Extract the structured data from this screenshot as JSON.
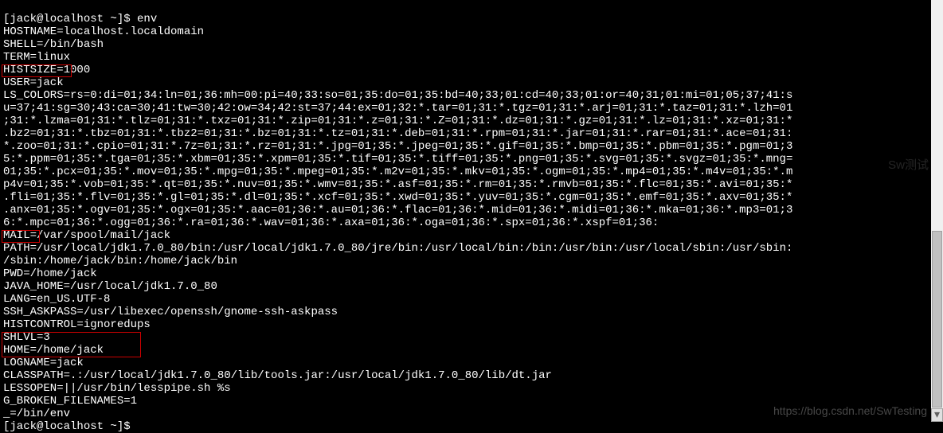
{
  "terminal": {
    "prompt1": "[jack@localhost ~]$ ",
    "cmd1": "env",
    "l1": "HOSTNAME=localhost.localdomain",
    "l2": "SHELL=/bin/bash",
    "l3": "TERM=linux",
    "l4": "HISTSIZE=1000",
    "l5": "USER=jack",
    "l6": "LS_COLORS=rs=0:di=01;34:ln=01;36:mh=00:pi=40;33:so=01;35:do=01;35:bd=40;33;01:cd=40;33;01:or=40;31;01:mi=01;05;37;41:s",
    "l7": "u=37;41:sg=30;43:ca=30;41:tw=30;42:ow=34;42:st=37;44:ex=01;32:*.tar=01;31:*.tgz=01;31:*.arj=01;31:*.taz=01;31:*.lzh=01",
    "l8": ";31:*.lzma=01;31:*.tlz=01;31:*.txz=01;31:*.zip=01;31:*.z=01;31:*.Z=01;31:*.dz=01;31:*.gz=01;31:*.lz=01;31:*.xz=01;31:*",
    "l9": ".bz2=01;31:*.tbz=01;31:*.tbz2=01;31:*.bz=01;31:*.tz=01;31:*.deb=01;31:*.rpm=01;31:*.jar=01;31:*.rar=01;31:*.ace=01;31:",
    "l10": "*.zoo=01;31:*.cpio=01;31:*.7z=01;31:*.rz=01;31:*.jpg=01;35:*.jpeg=01;35:*.gif=01;35:*.bmp=01;35:*.pbm=01;35:*.pgm=01;3",
    "l11": "5:*.ppm=01;35:*.tga=01;35:*.xbm=01;35:*.xpm=01;35:*.tif=01;35:*.tiff=01;35:*.png=01;35:*.svg=01;35:*.svgz=01;35:*.mng=",
    "l12": "01;35:*.pcx=01;35:*.mov=01;35:*.mpg=01;35:*.mpeg=01;35:*.m2v=01;35:*.mkv=01;35:*.ogm=01;35:*.mp4=01;35:*.m4v=01;35:*.m",
    "l13": "p4v=01;35:*.vob=01;35:*.qt=01;35:*.nuv=01;35:*.wmv=01;35:*.asf=01;35:*.rm=01;35:*.rmvb=01;35:*.flc=01;35:*.avi=01;35:*",
    "l14": ".fli=01;35:*.flv=01;35:*.gl=01;35:*.dl=01;35:*.xcf=01;35:*.xwd=01;35:*.yuv=01;35:*.cgm=01;35:*.emf=01;35:*.axv=01;35:*",
    "l15": ".anx=01;35:*.ogv=01;35:*.ogx=01;35:*.aac=01;36:*.au=01;36:*.flac=01;36:*.mid=01;36:*.midi=01;36:*.mka=01;36:*.mp3=01;3",
    "l16": "6:*.mpc=01;36:*.ogg=01;36:*.ra=01;36:*.wav=01;36:*.axa=01;36:*.oga=01;36:*.spx=01;36:*.xspf=01;36:",
    "l17": "MAIL=/var/spool/mail/jack",
    "l18a": "PATH=",
    "l18b": "/usr/local/jdk1.7.0_80/bin:/usr/local/jdk1.7.0_80/jre/bin:/usr/local/bin:/bin:/usr/bin:/usr/local/sbin:/usr/sbin:",
    "l19": "/sbin:/home/jack/bin:/home/jack/bin",
    "l20": "PWD=/home/jack",
    "l21": "JAVA_HOME=/usr/local/jdk1.7.0_80",
    "l22": "LANG=en_US.UTF-8",
    "l23": "SSH_ASKPASS=/usr/libexec/openssh/gnome-ssh-askpass",
    "l24": "HISTCONTROL=ignoredups",
    "l25": "SHLVL=3",
    "l26": "HOME=/home/jack",
    "l27": "LOGNAME=jack",
    "l28": "CLASSPATH=.:/usr/local/jdk1.7.0_80/lib/tools.jar:/usr/local/jdk1.7.0_80/lib/dt.jar",
    "l29": "LESSOPEN=||/usr/bin/lesspipe.sh %s",
    "l30": "G_BROKEN_FILENAMES=1",
    "l31": "_=/bin/env",
    "prompt2": "[jack@localhost ~]$ "
  },
  "watermark": "https://blog.csdn.net/SwTesting",
  "watermark2": "Sw测试"
}
